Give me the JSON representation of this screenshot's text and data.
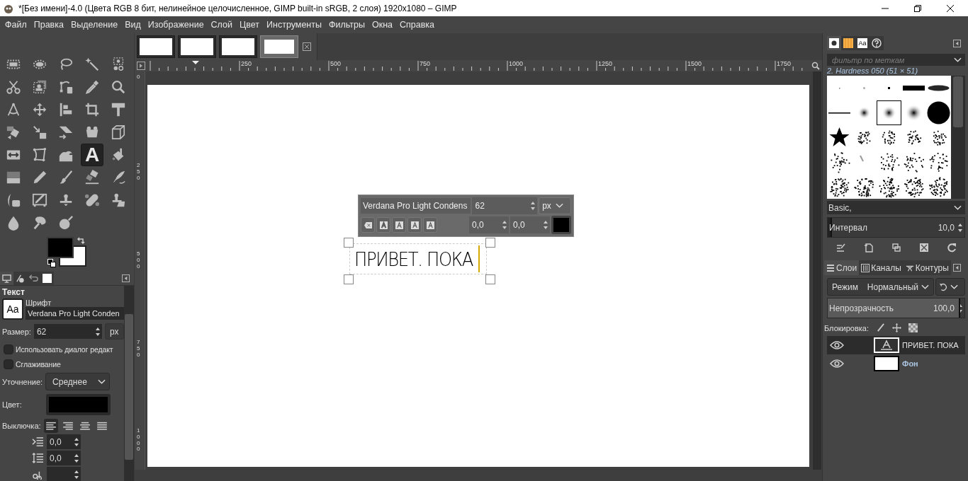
{
  "window": {
    "title": "*[Без имени]-4.0 (Цвета RGB 8 бит, нелинейное целочисленное, GIMP built-in sRGB, 2 слоя) 1920x1080 – GIMP"
  },
  "menu": [
    "Файл",
    "Правка",
    "Выделение",
    "Вид",
    "Изображение",
    "Слой",
    "Цвет",
    "Инструменты",
    "Фильтры",
    "Окна",
    "Справка"
  ],
  "tools": [
    {
      "selected": false
    },
    {
      "selected": false
    },
    {
      "selected": false
    },
    {
      "selected": false
    },
    {
      "selected": false
    },
    {
      "selected": false
    },
    {
      "selected": false
    },
    {
      "selected": false
    },
    {
      "selected": false
    },
    {
      "selected": false
    },
    {
      "selected": false
    },
    {
      "selected": false
    },
    {
      "selected": false
    },
    {
      "selected": false
    },
    {
      "selected": false
    },
    {
      "selected": false
    },
    {
      "selected": false
    },
    {
      "selected": false
    },
    {
      "selected": false
    },
    {
      "selected": false
    },
    {
      "selected": false
    },
    {
      "selected": false
    },
    {
      "selected": false
    },
    {
      "selected": true,
      "glyph": "A"
    },
    {
      "selected": false
    },
    {
      "selected": false
    },
    {
      "selected": false
    },
    {
      "selected": false
    },
    {
      "selected": false
    },
    {
      "selected": false
    },
    {
      "selected": false
    },
    {
      "selected": false
    },
    {
      "selected": false
    },
    {
      "selected": false
    },
    {
      "selected": false
    },
    {
      "selected": false
    },
    {
      "selected": false
    },
    {
      "selected": false
    }
  ],
  "dock_tabs": [
    {
      "selected": true
    },
    {
      "selected": false
    },
    {
      "selected": false
    },
    {
      "selected": false
    }
  ],
  "tool_options": {
    "title": "Текст",
    "font_label": "Шрифт",
    "font_preview": "Aa",
    "font": "Verdana Pro Light Conden",
    "size_label": "Размер:",
    "size": "62",
    "size_unit": "px",
    "options": [
      {
        "label": "Использовать диалог редакт",
        "checked": false
      },
      {
        "label": "Сглаживание",
        "checked": false
      }
    ],
    "hinting_label": "Уточнение:",
    "hinting": "Среднее",
    "color_label": "Цвет:",
    "justify_label": "Выключка:",
    "justify": [
      {
        "selected": true
      },
      {
        "selected": false
      },
      {
        "selected": false
      },
      {
        "selected": false
      }
    ],
    "spacing": [
      "0,0",
      "0,0"
    ]
  },
  "images": [
    {
      "selected": false
    },
    {
      "selected": false
    },
    {
      "selected": false
    },
    {
      "selected": true
    }
  ],
  "rulers": {
    "horizontal": [
      "250",
      "500",
      "750",
      "1000",
      "1250",
      "1500",
      "1750"
    ],
    "vertical": [
      "0",
      "250",
      "500",
      "750",
      "1000"
    ]
  },
  "text_toolbar": {
    "font": "Verdana Pro Light Condens",
    "size": "62",
    "unit": "px",
    "baseline": "0,0",
    "kerning": "0,0"
  },
  "canvas_text": "ПРИВЕТ. ПОКА",
  "brushes": {
    "tabs": [
      {
        "selected": true
      },
      {
        "selected": false
      },
      {
        "selected": false,
        "glyph": "Aa"
      },
      {
        "selected": false
      }
    ],
    "filter_placeholder": "фильтр по меткам",
    "name": "2. Hardness 050 (51 × 51)",
    "items": [
      {
        "selected": false
      },
      {
        "selected": false
      },
      {
        "selected": false
      },
      {
        "selected": false
      },
      {
        "selected": false
      },
      {
        "selected": false
      },
      {
        "selected": false
      },
      {
        "selected": true
      },
      {
        "selected": false
      },
      {
        "selected": false
      },
      {
        "selected": false
      },
      {
        "selected": false
      },
      {
        "selected": false
      },
      {
        "selected": false
      },
      {
        "selected": false
      },
      {
        "selected": false
      },
      {
        "selected": false
      },
      {
        "selected": false
      },
      {
        "selected": false
      },
      {
        "selected": false
      },
      {
        "selected": false
      },
      {
        "selected": false
      },
      {
        "selected": false
      },
      {
        "selected": false
      },
      {
        "selected": false
      }
    ],
    "preset": "Basic,",
    "spacing": {
      "label": "Интервал",
      "value": "10,0",
      "level": 0.02
    }
  },
  "layers": {
    "tabs": [
      {
        "label": "Слои",
        "selected": true
      },
      {
        "label": "Каналы",
        "selected": false
      },
      {
        "label": "Контуры",
        "selected": false
      }
    ],
    "mode_label": "Режим",
    "mode": "Нормальный",
    "opacity": {
      "label": "Непрозрачность",
      "value": "100,0",
      "level": 1
    },
    "lock_label": "Блокировка:",
    "items": [
      {
        "name": "ПРИВЕТ. ПОКА",
        "kind": "text",
        "visible": true,
        "selected": true
      },
      {
        "name": "Фон",
        "kind": "raster",
        "visible": true,
        "selected": false
      }
    ]
  }
}
